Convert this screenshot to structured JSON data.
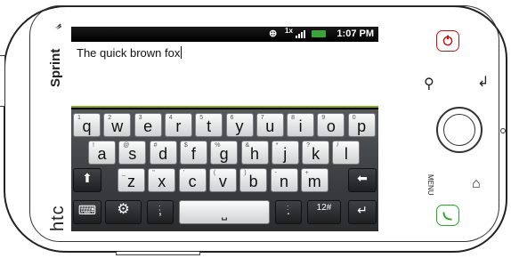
{
  "carrier": "Sprint",
  "brand": "htc",
  "status_bar": {
    "time": "1:07 PM",
    "network": "1x",
    "gps_icon": "gps-icon",
    "signal_icon": "signal-icon",
    "battery_icon": "battery-icon"
  },
  "text_field": {
    "value": "The quick brown fox"
  },
  "keyboard": {
    "row1": [
      {
        "main": "q",
        "alt": "1"
      },
      {
        "main": "w",
        "alt": "2"
      },
      {
        "main": "e",
        "alt": "3"
      },
      {
        "main": "r",
        "alt": "4"
      },
      {
        "main": "t",
        "alt": "5"
      },
      {
        "main": "y",
        "alt": "6"
      },
      {
        "main": "u",
        "alt": "7"
      },
      {
        "main": "i",
        "alt": "8"
      },
      {
        "main": "o",
        "alt": "9"
      },
      {
        "main": "p",
        "alt": "0"
      }
    ],
    "row2": [
      {
        "main": "a",
        "alt": "!"
      },
      {
        "main": "s",
        "alt": "@"
      },
      {
        "main": "d",
        "alt": "#"
      },
      {
        "main": "f",
        "alt": "$"
      },
      {
        "main": "g",
        "alt": "%"
      },
      {
        "main": "h",
        "alt": "&"
      },
      {
        "main": "j",
        "alt": "*"
      },
      {
        "main": "k",
        "alt": "?"
      },
      {
        "main": "l",
        "alt": "/"
      }
    ],
    "row3": [
      {
        "main": "z",
        "alt": "_"
      },
      {
        "main": "x",
        "alt": "\""
      },
      {
        "main": "c",
        "alt": "'"
      },
      {
        "main": "v",
        "alt": "("
      },
      {
        "main": "b",
        "alt": ")"
      },
      {
        "main": "n",
        "alt": "-"
      },
      {
        "main": "m",
        "alt": "+"
      }
    ],
    "shift_label": "⬆",
    "backspace_label": "⬅",
    "keyboard_toggle_label": "⌨",
    "settings_label": "⚙",
    "semicolon_label": ";",
    "comma_label": ",",
    "space_label": "⎵",
    "colon_label": ":",
    "period_label": ".",
    "numbers_label": "12#",
    "enter_label": "↵"
  },
  "hardware": {
    "menu_label": "MENU"
  }
}
